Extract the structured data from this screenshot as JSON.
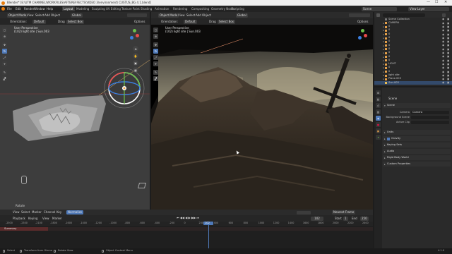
{
  "window": {
    "title": "Blender* [E:\\UTM CHANNEL\\WORKFILES\\AFTEREFFECTS\\VIDEO 3\\environment\\ CUSTUS_BG 4.1.blend]",
    "min": "—",
    "max": "☐",
    "close": "✕"
  },
  "menu": [
    "File",
    "Edit",
    "Render",
    "Window",
    "Help"
  ],
  "workspaces": [
    "Layout",
    "Modeling",
    "Sculpting",
    "UV Editing",
    "Texture Paint",
    "Shading",
    "Animation",
    "Rendering",
    "Compositing",
    "Geometry Nodes",
    "Scripting"
  ],
  "active_workspace": "Layout",
  "scene": {
    "label": "Scene",
    "view_layer": "View Layer"
  },
  "left_view": {
    "mode": "Object Mode",
    "menus": [
      "View",
      "Select",
      "Add",
      "Object"
    ],
    "orientation_label": "Orientation:",
    "orientation": "Default",
    "drag_label": "Drag",
    "drag": "Select Box",
    "transform": "Global",
    "options": "Options",
    "overlay_title": "User Perspective",
    "overlay_sub": "(102) light site | Sun.003"
  },
  "right_view": {
    "mode": "Object Mode",
    "menus": [
      "View",
      "Select",
      "Add",
      "Object"
    ],
    "orientation_label": "Orientation:",
    "orientation": "Default",
    "drag_label": "Drag",
    "drag": "Select Box",
    "transform": "Global",
    "options": "Options",
    "overlay_title": "User Perspective",
    "overlay_sub": "(102) light site | Sun.003"
  },
  "rotate_op": "Rotate",
  "outliner": {
    "rows": [
      {
        "exp": "",
        "label": "Scene Collection",
        "color": "#7a7a7a"
      },
      {
        "exp": "▸",
        "label": "CAMERA",
        "color": "#e8a24a"
      },
      {
        "exp": "▸",
        "label": "0",
        "color": "#e8a24a"
      },
      {
        "exp": "▸",
        "label": "0",
        "color": "#e8a24a"
      },
      {
        "exp": "▸",
        "label": "0",
        "color": "#e8a24a"
      },
      {
        "exp": "▸",
        "label": "0",
        "color": "#e8a24a"
      },
      {
        "exp": "▸",
        "label": "0",
        "color": "#e8a24a"
      },
      {
        "exp": "▸",
        "label": "0",
        "color": "#e8a24a"
      },
      {
        "exp": "▸",
        "label": "0",
        "color": "#e8a24a"
      },
      {
        "exp": "▸",
        "label": "0",
        "color": "#e8a24a"
      },
      {
        "exp": "▸",
        "label": "0",
        "color": "#e8a24a"
      },
      {
        "exp": "▸",
        "label": "0",
        "color": "#e8a24a"
      },
      {
        "exp": "▸",
        "label": "LIGHT",
        "color": "#e8a24a"
      },
      {
        "exp": "▸",
        "label": "0",
        "color": "#e8a24a"
      },
      {
        "exp": "▸",
        "label": "0",
        "color": "#e8a24a"
      },
      {
        "exp": "▾",
        "label": "light site",
        "color": "#e8a24a"
      },
      {
        "exp": "▸",
        "label": "Plane.003",
        "color": "#e8a24a"
      },
      {
        "exp": "",
        "label": "Sun.003",
        "color": "#f0c050"
      }
    ]
  },
  "properties": {
    "header": "Scene",
    "scene_section": "Scene",
    "fields": [
      {
        "label": "Camera",
        "value": "Camera"
      },
      {
        "label": "Background Scene",
        "value": ""
      },
      {
        "label": "Active Clip",
        "value": ""
      }
    ],
    "sections": [
      "Units",
      "Gravity",
      "Keying Sets",
      "Audio",
      "Rigid Body World",
      "Custom Properties"
    ]
  },
  "timeline": {
    "menus": [
      "View",
      "Select",
      "Marker",
      "Channel",
      "Key"
    ],
    "mode": "Normalize",
    "menus2": [
      "Playback",
      "Keying",
      "View",
      "Marker"
    ],
    "channel": "Summary",
    "frame": "102",
    "start_label": "Start",
    "start": "1",
    "end_label": "End",
    "end": "250",
    "interp": "Nearest Frame",
    "ticks": [
      "-2500",
      "-2300",
      "-2100",
      "-1800",
      "-1600",
      "-1400",
      "-1200",
      "-1000",
      "-800",
      "-600",
      "-400",
      "-200",
      "0",
      "200",
      "400",
      "600",
      "800",
      "1000",
      "1200",
      "1400",
      "1600",
      "1800",
      "2000",
      "2200",
      "2400"
    ]
  },
  "status": [
    "Select",
    "Transform from Gizmo",
    "Rotate View",
    "Object Context Menu"
  ],
  "version": "4.1.0"
}
